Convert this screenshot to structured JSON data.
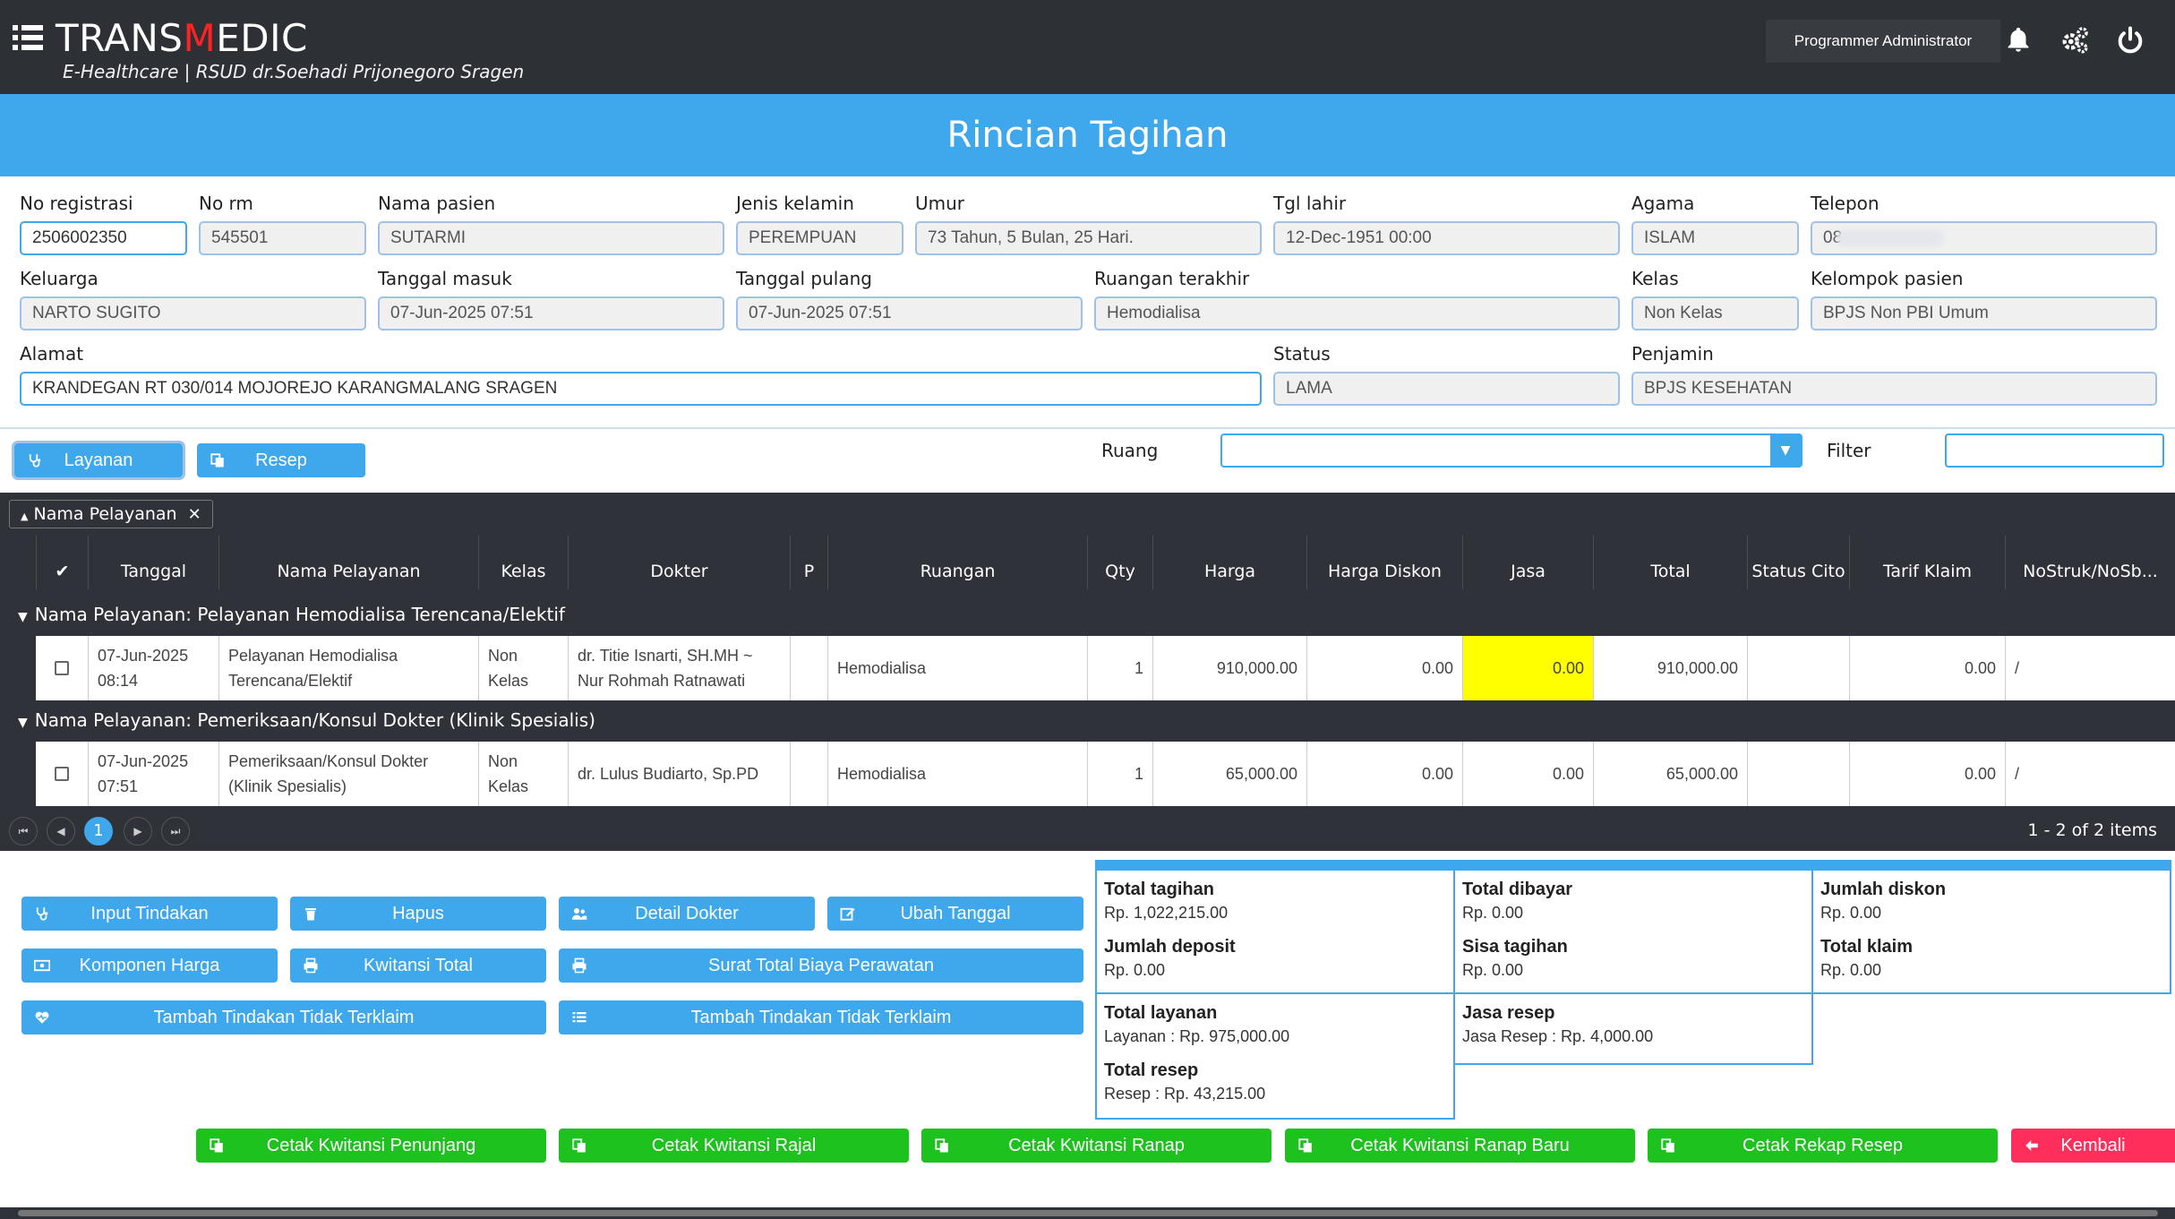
{
  "header": {
    "brand_pre": "TRANS",
    "brand_m": "M",
    "brand_post": "EDIC",
    "subtitle": "E-Healthcare | RSUD dr.Soehadi Prijonegoro Sragen",
    "user": "Programmer Administrator",
    "icons": [
      "menu-icon",
      "bell-icon",
      "gears-icon",
      "power-icon"
    ]
  },
  "page_title": "Rincian Tagihan",
  "patient": {
    "no_registrasi": {
      "label": "No registrasi",
      "value": "2506002350"
    },
    "no_rm": {
      "label": "No rm",
      "value": "545501"
    },
    "nama_pasien": {
      "label": "Nama pasien",
      "value": "SUTARMI"
    },
    "jenis_kelamin": {
      "label": "Jenis kelamin",
      "value": "PEREMPUAN"
    },
    "umur": {
      "label": "Umur",
      "value": "73 Tahun, 5 Bulan, 25 Hari."
    },
    "tgl_lahir": {
      "label": "Tgl lahir",
      "value": "12-Dec-1951 00:00"
    },
    "agama": {
      "label": "Agama",
      "value": "ISLAM"
    },
    "telepon": {
      "label": "Telepon",
      "value": "08"
    },
    "keluarga": {
      "label": "Keluarga",
      "value": "NARTO SUGITO"
    },
    "tanggal_masuk": {
      "label": "Tanggal masuk",
      "value": "07-Jun-2025 07:51"
    },
    "tanggal_pulang": {
      "label": "Tanggal pulang",
      "value": "07-Jun-2025 07:51"
    },
    "ruangan_terakhir": {
      "label": "Ruangan terakhir",
      "value": "Hemodialisa"
    },
    "kelas": {
      "label": "Kelas",
      "value": "Non Kelas"
    },
    "kelompok_pasien": {
      "label": "Kelompok pasien",
      "value": "BPJS Non PBI Umum"
    },
    "alamat": {
      "label": "Alamat",
      "value": "KRANDEGAN RT 030/014 MOJOREJO KARANGMALANG SRAGEN"
    },
    "status": {
      "label": "Status",
      "value": "LAMA"
    },
    "penjamin": {
      "label": "Penjamin",
      "value": "BPJS KESEHATAN"
    }
  },
  "tabs": {
    "layanan": "Layanan",
    "resep": "Resep"
  },
  "filters": {
    "ruang_label": "Ruang",
    "ruang_value": "",
    "filter_label": "Filter",
    "filter_value": ""
  },
  "grid": {
    "group_chip": "Nama Pelayanan",
    "columns": [
      "Tanggal",
      "Nama Pelayanan",
      "Kelas",
      "Dokter",
      "P",
      "Ruangan",
      "Qty",
      "Harga",
      "Harga Diskon",
      "Jasa",
      "Total",
      "Status Cito",
      "Tarif Klaim",
      "NoStruk/NoSb..."
    ],
    "groups": [
      {
        "title": "Nama Pelayanan: Pelayanan Hemodialisa Terencana/Elektif",
        "row": {
          "tanggal": "07-Jun-2025 08:14",
          "nama": "Pelayanan Hemodialisa Terencana/Elektif",
          "kelas": "Non Kelas",
          "dokter": "dr. Titie Isnarti, SH.MH ~ Nur Rohmah Ratnawati",
          "p": "",
          "ruangan": "Hemodialisa",
          "qty": "1",
          "harga": "910,000.00",
          "harga_diskon": "0.00",
          "jasa": "0.00",
          "total": "910,000.00",
          "status_cito": "",
          "tarif_klaim": "0.00",
          "nostruk": "/"
        }
      },
      {
        "title": "Nama Pelayanan: Pemeriksaan/Konsul Dokter (Klinik Spesialis)",
        "row": {
          "tanggal": "07-Jun-2025 07:51",
          "nama": "Pemeriksaan/Konsul Dokter (Klinik Spesialis)",
          "kelas": "Non Kelas",
          "dokter": "dr. Lulus Budiarto, Sp.PD",
          "p": "",
          "ruangan": "Hemodialisa",
          "qty": "1",
          "harga": "65,000.00",
          "harga_diskon": "0.00",
          "jasa": "0.00",
          "total": "65,000.00",
          "status_cito": "",
          "tarif_klaim": "0.00",
          "nostruk": "/"
        }
      }
    ],
    "pager": {
      "current": "1",
      "info": "1 - 2 of 2 items"
    },
    "highlight_color": "#ffff00"
  },
  "actions": {
    "input_tindakan": "Input Tindakan",
    "hapus": "Hapus",
    "detail_dokter": "Detail Dokter",
    "ubah_tanggal": "Ubah Tanggal",
    "komponen_harga": "Komponen Harga",
    "kwitansi_total": "Kwitansi Total",
    "surat_total": "Surat Total Biaya Perawatan",
    "tambah_tidak_terklaim_1": "Tambah Tindakan Tidak Terklaim",
    "tambah_tidak_terklaim_2": "Tambah Tindakan Tidak Terklaim"
  },
  "summary": {
    "total_tagihan": {
      "label": "Total tagihan",
      "value": "Rp. 1,022,215.00"
    },
    "jumlah_deposit": {
      "label": "Jumlah deposit",
      "value": "Rp. 0.00"
    },
    "total_dibayar": {
      "label": "Total dibayar",
      "value": "Rp. 0.00"
    },
    "sisa_tagihan": {
      "label": "Sisa tagihan",
      "value": "Rp. 0.00"
    },
    "jumlah_diskon": {
      "label": "Jumlah diskon",
      "value": "Rp. 0.00"
    },
    "total_klaim": {
      "label": "Total klaim",
      "value": "Rp. 0.00"
    },
    "total_layanan": {
      "label": "Total layanan",
      "value": "Layanan : Rp. 975,000.00"
    },
    "total_resep": {
      "label": "Total resep",
      "value": "Resep : Rp. 43,215.00"
    },
    "jasa_resep": {
      "label": "Jasa resep",
      "value": "Jasa Resep : Rp. 4,000.00"
    }
  },
  "footer_buttons": {
    "penunjang": "Cetak Kwitansi Penunjang",
    "rajal": "Cetak Kwitansi Rajal",
    "ranap": "Cetak Kwitansi Ranap",
    "ranap_baru": "Cetak Kwitansi Ranap Baru",
    "rekap_resep": "Cetak Rekap Resep",
    "kembali": "Kembali"
  },
  "colors": {
    "header": "#2d3035",
    "accent": "#3fa8ec",
    "green": "#1ec21e",
    "red": "#ff2e5a"
  }
}
